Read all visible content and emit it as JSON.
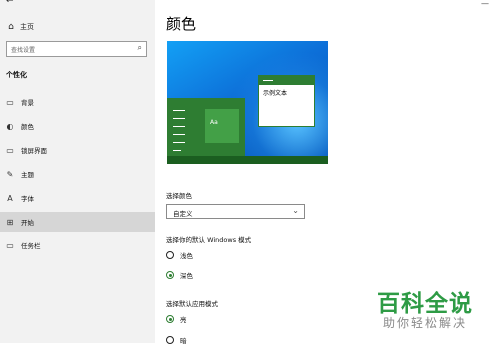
{
  "sidebar": {
    "back_glyph": "←",
    "home": {
      "icon": "home-icon",
      "glyph": "⌂",
      "label": "主页"
    },
    "search": {
      "placeholder": "查找设置",
      "icon": "search-icon",
      "glyph": "⌕"
    },
    "section": "个性化",
    "items": [
      {
        "icon": "background-image-icon",
        "glyph": "▭",
        "label": "背景",
        "active": false
      },
      {
        "icon": "palette-icon",
        "glyph": "◐",
        "label": "颜色",
        "active": false
      },
      {
        "icon": "lock-screen-icon",
        "glyph": "▭",
        "label": "锁屏界面",
        "active": false
      },
      {
        "icon": "theme-brush-icon",
        "glyph": "✎",
        "label": "主题",
        "active": false
      },
      {
        "icon": "font-icon",
        "glyph": "A",
        "label": "字体",
        "active": false
      },
      {
        "icon": "start-icon",
        "glyph": "⊞",
        "label": "开始",
        "active": true
      },
      {
        "icon": "taskbar-icon",
        "glyph": "▭",
        "label": "任务栏",
        "active": false
      }
    ]
  },
  "main": {
    "title": "颜色",
    "preview": {
      "tile_text": "Aa",
      "window_text": "示例文本"
    },
    "choose_color": {
      "label": "选择颜色",
      "value": "自定义",
      "chevron": "⌄"
    },
    "windows_mode": {
      "label": "选择你的默认 Windows 模式",
      "options": [
        {
          "label": "浅色",
          "selected": false
        },
        {
          "label": "深色",
          "selected": true
        }
      ]
    },
    "app_mode": {
      "label": "选择默认应用模式",
      "options": [
        {
          "label": "亮",
          "selected": true
        },
        {
          "label": "暗",
          "selected": false
        }
      ]
    }
  },
  "colors": {
    "accent": "#2e7d32",
    "wallpaper": "#0d6fd8"
  },
  "watermark": {
    "line1": "百科全说",
    "line2": "助你轻松解决"
  }
}
